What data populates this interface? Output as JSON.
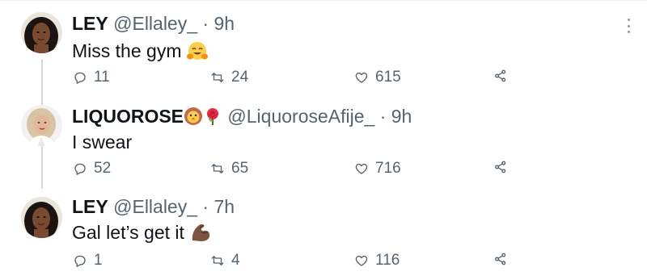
{
  "tweets": [
    {
      "name": "LEY",
      "handle": "@Ellaley_",
      "separator": "·",
      "time": "9h",
      "text": "Miss the gym",
      "emoji": "smiling-hugging-face",
      "replies": "11",
      "retweets": "24",
      "likes": "615"
    },
    {
      "name": "LIQUOROSE",
      "name_emojis": [
        "lion-face",
        "rose"
      ],
      "handle": "@LiquoroseAfije_",
      "separator": "·",
      "time": "9h",
      "text": "I swear",
      "replies": "52",
      "retweets": "65",
      "likes": "716"
    },
    {
      "name": "LEY",
      "handle": "@Ellaley_",
      "separator": "·",
      "time": "7h",
      "text": "Gal let’s get it",
      "emoji": "flexed-biceps-dark-skin",
      "replies": "1",
      "retweets": "4",
      "likes": "116"
    }
  ],
  "colors": {
    "text": "#0f1419",
    "secondary": "#536471",
    "thread_line": "#cfd9de"
  }
}
